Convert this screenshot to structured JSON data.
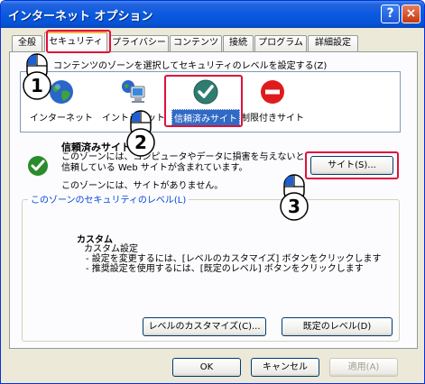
{
  "window": {
    "title": "インターネット オプション",
    "help": "?",
    "close": "×"
  },
  "tabs": [
    {
      "label": "全般"
    },
    {
      "label": "セキュリティ"
    },
    {
      "label": "プライバシー"
    },
    {
      "label": "コンテンツ"
    },
    {
      "label": "接続"
    },
    {
      "label": "プログラム"
    },
    {
      "label": "詳細設定"
    }
  ],
  "security": {
    "instruction": "コンテンツのゾーンを選択してセキュリティのレベルを設定する(Z)",
    "zones": [
      {
        "label": "インターネット",
        "icon": "globe-icon"
      },
      {
        "label": "イントラネット",
        "icon": "intranet-icon"
      },
      {
        "label": "信頼済みサイト",
        "icon": "checkmark-icon",
        "selected": true
      },
      {
        "label": "制限付きサイト",
        "icon": "restricted-icon"
      }
    ],
    "selected_zone": {
      "title": "信頼済みサイト",
      "desc_line1": "このゾーンには、コンピュータやデータに損害を与えないと",
      "desc_line2": "信頼している Web サイトが含まれています。",
      "desc_line3": "このゾーンには、サイトがありません。",
      "sites_button": "サイト(S)..."
    },
    "level_group": {
      "legend": "このゾーンのセキュリティのレベル(L)",
      "custom_title": "カスタム",
      "custom_line1": "カスタム設定",
      "custom_line2": "- 設定を変更するには、[レベルのカスタマイズ] ボタンをクリックします",
      "custom_line3": "- 推奨設定を使用するには、[既定のレベル] ボタンをクリックします",
      "customize_button": "レベルのカスタマイズ(C)...",
      "default_button": "既定のレベル(D)"
    }
  },
  "footer": {
    "ok": "OK",
    "cancel": "キャンセル",
    "apply": "適用(A)"
  },
  "steps": [
    "1",
    "2",
    "3"
  ],
  "colors": {
    "highlight_box": "#e0103a",
    "selection": "#316ac5",
    "title_bar": "#0553d6",
    "group_legend": "#0046d5"
  }
}
